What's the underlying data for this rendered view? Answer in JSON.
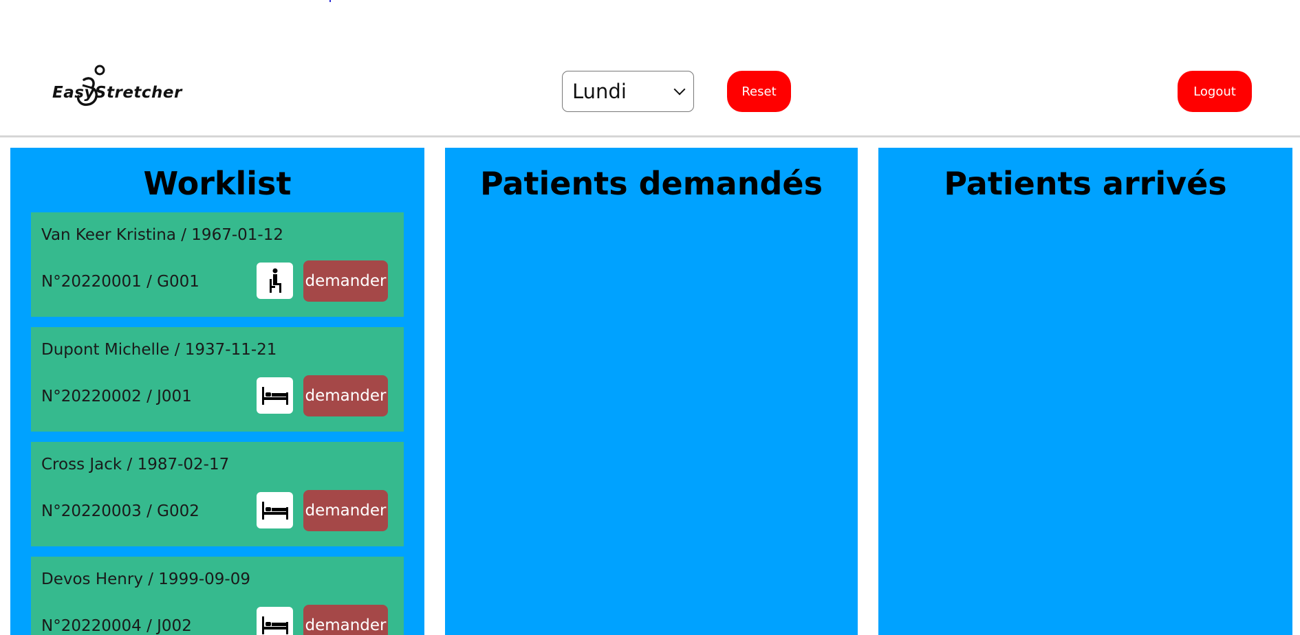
{
  "header": {
    "logo_text": "EasyStretcher",
    "day_select": {
      "selected": "Lundi",
      "options": [
        "Lundi"
      ]
    },
    "reset_label": "Reset",
    "logout_label": "Logout"
  },
  "panels": {
    "worklist": {
      "title": "Worklist"
    },
    "requested": {
      "title": "Patients demandés"
    },
    "arrived": {
      "title": "Patients arrivés"
    }
  },
  "worklist": [
    {
      "name": "Van Keer Kristina / 1967-01-12",
      "id": "N°20220001 / G001",
      "transport": "chair",
      "button": "demander"
    },
    {
      "name": "Dupont Michelle / 1937-11-21",
      "id": "N°20220002 / J001",
      "transport": "bed",
      "button": "demander"
    },
    {
      "name": "Cross Jack / 1987-02-17",
      "id": "N°20220003 / G002",
      "transport": "bed",
      "button": "demander"
    },
    {
      "name": "Devos Henry / 1999-09-09",
      "id": "N°20220004 / J002",
      "transport": "bed",
      "button": "demander"
    }
  ],
  "icons": {
    "chair": "seated-person-icon",
    "bed": "bed-icon"
  },
  "colors": {
    "accent_red": "#ff0000",
    "panel_blue": "#00a2ff",
    "card_green": "#36ba8e",
    "request_button": "#a54848"
  }
}
